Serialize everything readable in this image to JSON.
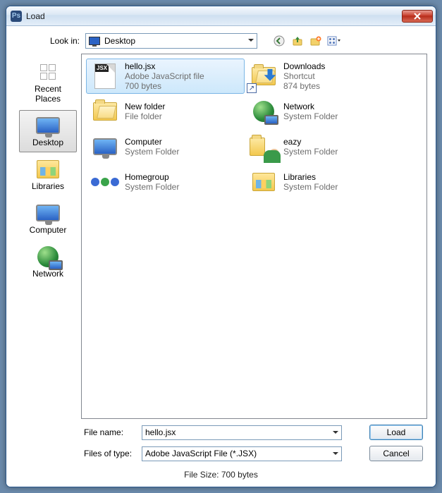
{
  "window": {
    "title": "Load"
  },
  "lookin": {
    "label": "Look in:",
    "value": "Desktop"
  },
  "toolbar_icons": [
    "back-icon",
    "up-one-level-icon",
    "new-folder-icon",
    "view-menu-icon"
  ],
  "places": [
    {
      "key": "recent",
      "label": "Recent Places"
    },
    {
      "key": "desktop",
      "label": "Desktop",
      "selected": true
    },
    {
      "key": "libraries",
      "label": "Libraries"
    },
    {
      "key": "computer",
      "label": "Computer"
    },
    {
      "key": "network",
      "label": "Network"
    }
  ],
  "items": [
    {
      "name": "hello.jsx",
      "type": "Adobe JavaScript file",
      "size": "700 bytes",
      "icon": "jsx",
      "selected": true
    },
    {
      "name": "New folder",
      "type": "File folder",
      "size": "",
      "icon": "folder"
    },
    {
      "name": "Computer",
      "type": "System Folder",
      "size": "",
      "icon": "computer"
    },
    {
      "name": "Homegroup",
      "type": "System Folder",
      "size": "",
      "icon": "homegroup"
    },
    {
      "name": "Downloads",
      "type": "Shortcut",
      "size": "874 bytes",
      "icon": "downloads",
      "shortcut": true
    },
    {
      "name": "Network",
      "type": "System Folder",
      "size": "",
      "icon": "network"
    },
    {
      "name": "eazy",
      "type": "System Folder",
      "size": "",
      "icon": "user"
    },
    {
      "name": "Libraries",
      "type": "System Folder",
      "size": "",
      "icon": "libraries"
    }
  ],
  "filename": {
    "label": "File name:",
    "value": "hello.jsx"
  },
  "filetype": {
    "label": "Files of type:",
    "value": "Adobe JavaScript File (*.JSX)"
  },
  "buttons": {
    "load": "Load",
    "cancel": "Cancel"
  },
  "status": "File Size: 700 bytes"
}
